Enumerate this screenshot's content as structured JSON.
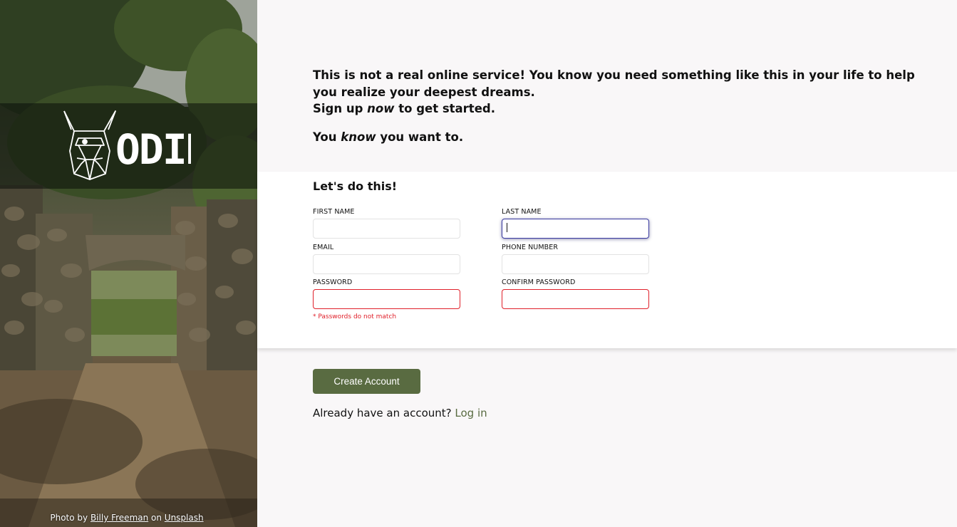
{
  "brand": {
    "logo_text": "ODIN",
    "icon": "viking-helmet-icon"
  },
  "photo_credit": {
    "prefix": "Photo by ",
    "author": "Billy Freeman",
    "middle": " on ",
    "source": "Unsplash"
  },
  "intro": {
    "line1": "This is not a real online service! You know you need something like this in your life to help you realize your deepest dreams.",
    "line2_prefix": "Sign up ",
    "line2_em": "now",
    "line2_suffix": " to get started.",
    "line3_prefix": "You ",
    "line3_em": "know",
    "line3_suffix": " you want to."
  },
  "form": {
    "title": "Let's do this!",
    "fields": {
      "first_name": {
        "label": "FIRST NAME",
        "value": ""
      },
      "last_name": {
        "label": "LAST NAME",
        "value": ""
      },
      "email": {
        "label": "EMAIL",
        "value": ""
      },
      "phone": {
        "label": "PHONE NUMBER",
        "value": ""
      },
      "password": {
        "label": "PASSWORD",
        "value": ""
      },
      "confirm_password": {
        "label": "CONFIRM PASSWORD",
        "value": ""
      }
    },
    "error": "* Passwords do not match"
  },
  "actions": {
    "create_label": "Create Account",
    "login_prompt": "Already have an account?",
    "login_link": "Log in"
  },
  "colors": {
    "accent": "#596b41",
    "error": "#e0202a",
    "focus": "#3a3aa0",
    "background": "#f9f7f8"
  }
}
